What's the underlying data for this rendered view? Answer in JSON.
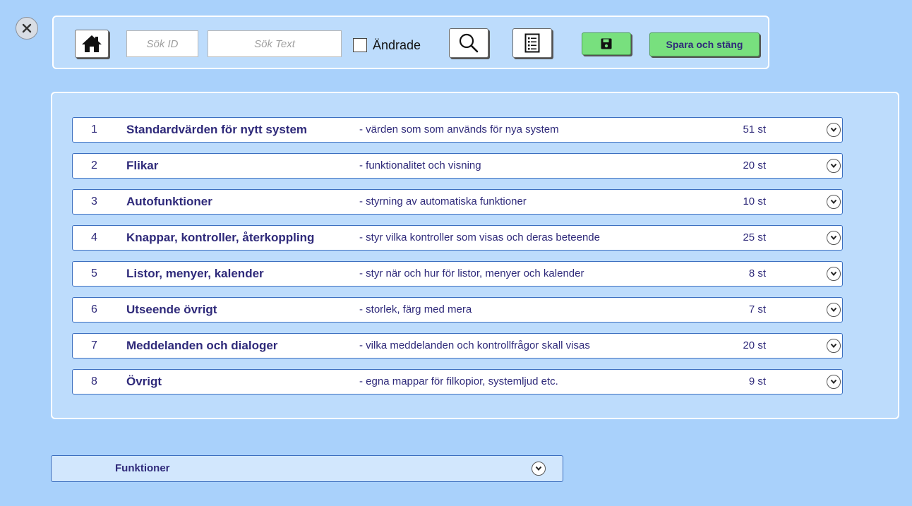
{
  "toolbar": {
    "search_id_placeholder": "Sök ID",
    "search_text_placeholder": "Sök Text",
    "changed_label": "Ändrade",
    "save_close_label": "Spara och stäng"
  },
  "colors": {
    "background": "#a9d1fb",
    "panel": "#bddcfc",
    "save_green": "#78e07e",
    "text_accent": "#2f2a7a",
    "row_border": "#3c6fc0"
  },
  "icons": [
    "close-icon",
    "home-icon",
    "search-icon",
    "list-icon",
    "floppy-disk-icon",
    "chevron-down-icon"
  ],
  "categories": [
    {
      "num": "1",
      "title": "Standardvärden för nytt system",
      "desc": "- värden som som används för nya system",
      "count": "51 st"
    },
    {
      "num": "2",
      "title": "Flikar",
      "desc": "- funktionalitet och visning",
      "count": "20 st"
    },
    {
      "num": "3",
      "title": "Autofunktioner",
      "desc": "- styrning av automatiska funktioner",
      "count": "10 st"
    },
    {
      "num": "4",
      "title": "Knappar, kontroller, återkoppling",
      "desc": "- styr vilka kontroller som visas och deras beteende",
      "count": "25 st"
    },
    {
      "num": "5",
      "title": "Listor, menyer, kalender",
      "desc": "- styr när och hur för listor, menyer och kalender",
      "count": "8 st"
    },
    {
      "num": "6",
      "title": "Utseende övrigt",
      "desc": "- storlek, färg med mera",
      "count": "7 st"
    },
    {
      "num": "7",
      "title": "Meddelanden och dialoger",
      "desc": "- vilka meddelanden och kontrollfrågor skall visas",
      "count": "20 st"
    },
    {
      "num": "8",
      "title": "Övrigt",
      "desc": "- egna mappar för filkopior, systemljud etc.",
      "count": "9 st"
    }
  ],
  "functions": {
    "label": "Funktioner"
  }
}
